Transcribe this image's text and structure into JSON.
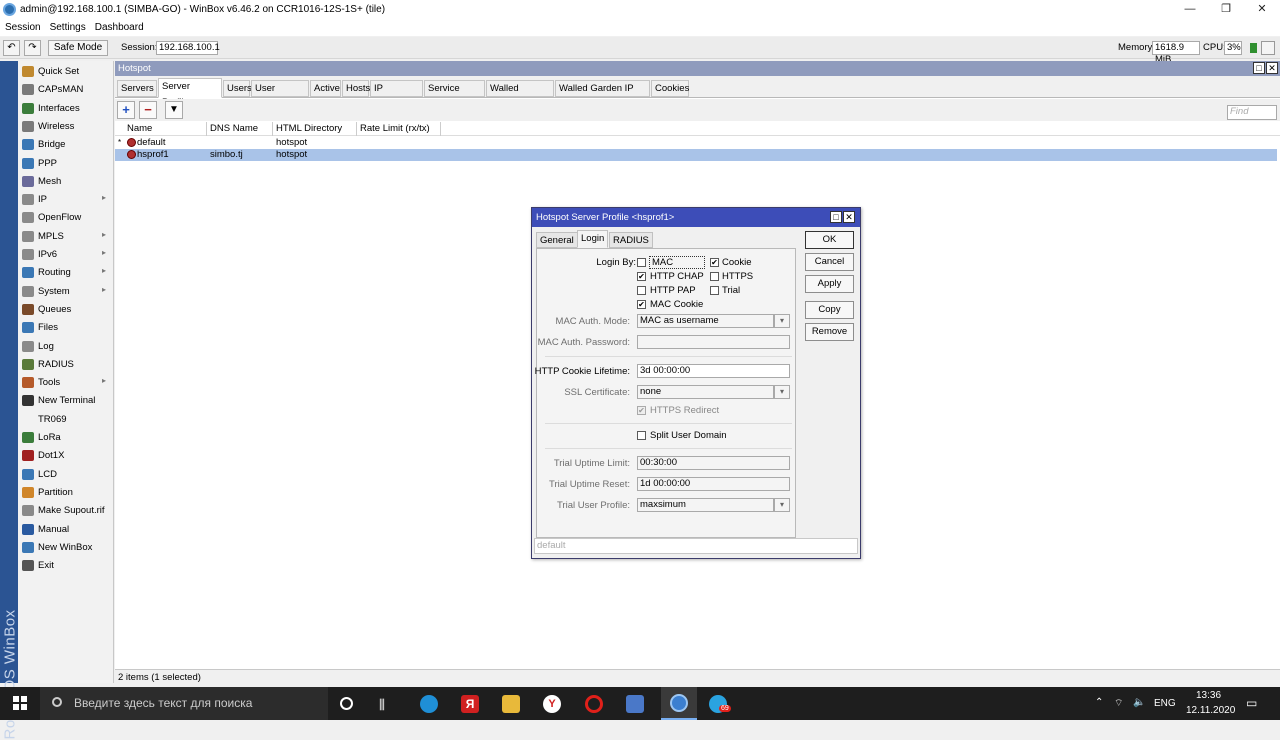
{
  "window": {
    "title": "admin@192.168.100.1 (SIMBA-GO) - WinBox v6.46.2 on CCR1016-12S-1S+ (tile)",
    "minimize": "—",
    "maximize": "❐",
    "close": "✕"
  },
  "menu": [
    "Session",
    "Settings",
    "Dashboard"
  ],
  "toolbar": {
    "undo": "↶",
    "redo": "↷",
    "safe_mode": "Safe Mode",
    "session_label": "Session:",
    "session_value": "192.168.100.1",
    "memory_label": "Memory:",
    "memory_value": "1618.9 MiB",
    "cpu_label": "CPU:",
    "cpu_value": "3%"
  },
  "vertical_brand": "RouterOS WinBox",
  "sidebar": [
    {
      "label": "Quick Set",
      "color": "#c0892f",
      "sub": false
    },
    {
      "label": "CAPsMAN",
      "color": "#7a7a7a",
      "sub": false
    },
    {
      "label": "Interfaces",
      "color": "#3b7d3b",
      "sub": false
    },
    {
      "label": "Wireless",
      "color": "#7a7a7a",
      "sub": false
    },
    {
      "label": "Bridge",
      "color": "#3b78b5",
      "sub": false
    },
    {
      "label": "PPP",
      "color": "#3b78b5",
      "sub": false
    },
    {
      "label": "Mesh",
      "color": "#6a6a9a",
      "sub": false
    },
    {
      "label": "IP",
      "color": "#8a8a8a",
      "sub": true
    },
    {
      "label": "OpenFlow",
      "color": "#8a8a8a",
      "sub": false
    },
    {
      "label": "MPLS",
      "color": "#8a8a8a",
      "sub": true
    },
    {
      "label": "IPv6",
      "color": "#8a8a8a",
      "sub": true
    },
    {
      "label": "Routing",
      "color": "#3b78b5",
      "sub": true
    },
    {
      "label": "System",
      "color": "#8a8a8a",
      "sub": true
    },
    {
      "label": "Queues",
      "color": "#7a4a2a",
      "sub": false
    },
    {
      "label": "Files",
      "color": "#3b78b5",
      "sub": false
    },
    {
      "label": "Log",
      "color": "#8a8a8a",
      "sub": false
    },
    {
      "label": "RADIUS",
      "color": "#5a7a3a",
      "sub": false
    },
    {
      "label": "Tools",
      "color": "#b55a2a",
      "sub": true
    },
    {
      "label": "New Terminal",
      "color": "#333333",
      "sub": false
    },
    {
      "label": "TR069",
      "color": "",
      "sub": false
    },
    {
      "label": "LoRa",
      "color": "#3b7d3b",
      "sub": false
    },
    {
      "label": "Dot1X",
      "color": "#a02020",
      "sub": false
    },
    {
      "label": "LCD",
      "color": "#3b78b5",
      "sub": false
    },
    {
      "label": "Partition",
      "color": "#d0862a",
      "sub": false
    },
    {
      "label": "Make Supout.rif",
      "color": "#8a8a8a",
      "sub": false
    },
    {
      "label": "Manual",
      "color": "#2a5aa0",
      "sub": false
    },
    {
      "label": "New WinBox",
      "color": "#3b78b5",
      "sub": false
    },
    {
      "label": "Exit",
      "color": "#555555",
      "sub": false
    }
  ],
  "hotspot": {
    "header": "Hotspot",
    "tabs": [
      "Servers",
      "Server Profiles",
      "Users",
      "User Profiles",
      "Active",
      "Hosts",
      "IP Bindings",
      "Service Ports",
      "Walled Garden",
      "Walled Garden IP List",
      "Cookies"
    ],
    "active_tab": "Server Profiles",
    "find_placeholder": "Find",
    "columns": [
      "Name",
      "DNS Name",
      "HTML Directory",
      "Rate Limit (rx/tx)"
    ],
    "rows": [
      {
        "marker": "*",
        "name": "default",
        "dns": "",
        "html": "hotspot",
        "rate": ""
      },
      {
        "marker": "",
        "name": "hsprof1",
        "dns": "simbo.tj",
        "html": "hotspot",
        "rate": ""
      }
    ],
    "status": "2 items (1 selected)"
  },
  "dialog": {
    "title": "Hotspot Server Profile <hsprof1>",
    "tabs": [
      "General",
      "Login",
      "RADIUS"
    ],
    "active_tab": "Login",
    "buttons": [
      "OK",
      "Cancel",
      "Apply",
      "Copy",
      "Remove"
    ],
    "login_by_label": "Login By:",
    "options": {
      "mac": "MAC",
      "cookie": "Cookie",
      "http_chap": "HTTP CHAP",
      "https": "HTTPS",
      "http_pap": "HTTP PAP",
      "trial": "Trial",
      "mac_cookie": "MAC Cookie"
    },
    "mac_auth_mode_label": "MAC Auth. Mode:",
    "mac_auth_mode_value": "MAC as username",
    "mac_auth_password_label": "MAC Auth. Password:",
    "mac_auth_password_value": "",
    "cookie_lifetime_label": "HTTP Cookie Lifetime:",
    "cookie_lifetime_value": "3d 00:00:00",
    "ssl_label": "SSL Certificate:",
    "ssl_value": "none",
    "https_redirect": "HTTPS Redirect",
    "split_user_domain": "Split User Domain",
    "trial_uptime_limit_label": "Trial Uptime Limit:",
    "trial_uptime_limit_value": "00:30:00",
    "trial_uptime_reset_label": "Trial Uptime Reset:",
    "trial_uptime_reset_value": "1d 00:00:00",
    "trial_user_profile_label": "Trial User Profile:",
    "trial_user_profile_value": "maxsimum",
    "status": "default"
  },
  "taskbar": {
    "search_placeholder": "Введите здесь текст для поиска",
    "lang": "ENG",
    "time": "13:36",
    "date": "12.11.2020",
    "badge": "69"
  }
}
